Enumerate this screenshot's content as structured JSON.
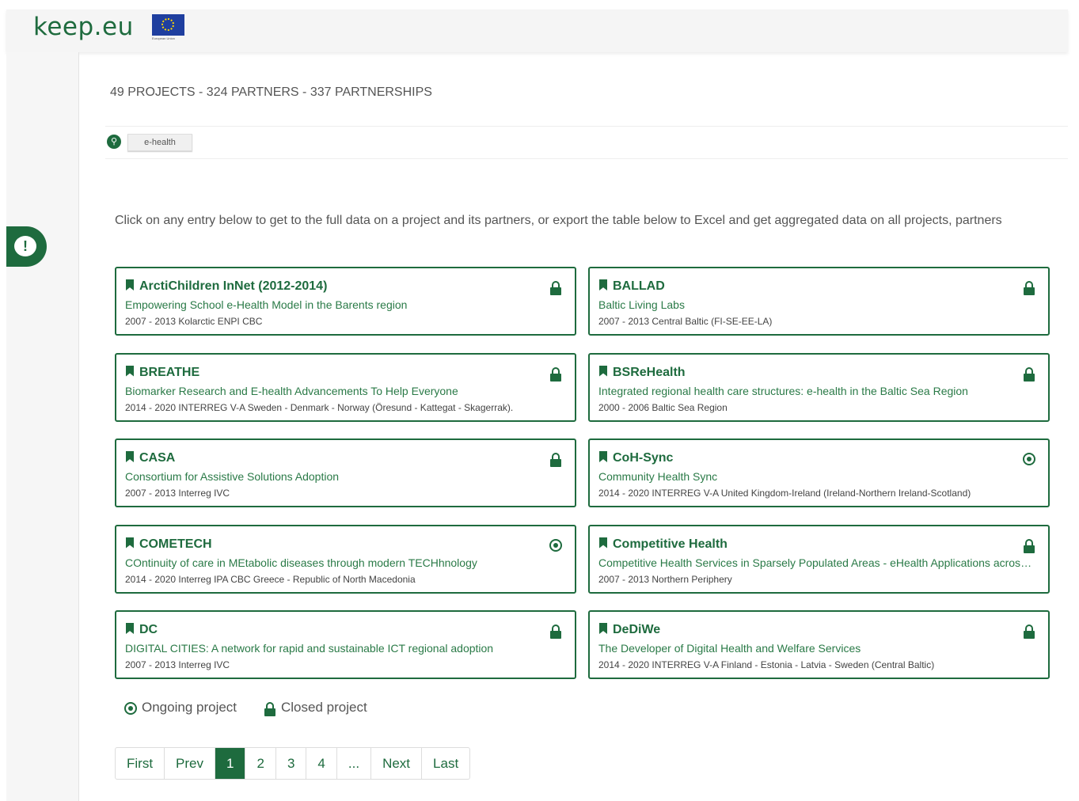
{
  "header": {
    "logo_text": "keep.eu",
    "eu_label": "European Union"
  },
  "summary": "49 PROJECTS - 324 PARTNERS - 337 PARTNERSHIPS",
  "filter": {
    "tag": "e-health"
  },
  "intro": "Click on any entry below to get to the full data on a project and its partners, or export the table below to Excel and get aggregated data on all projects, partners",
  "projects": [
    {
      "title": "ArctiChildren InNet (2012-2014)",
      "subtitle": "Empowering School e-Health Model in the Barents region",
      "meta": "2007 - 2013 Kolarctic ENPI CBC",
      "status": "closed"
    },
    {
      "title": "BALLAD",
      "subtitle": "Baltic Living Labs",
      "meta": "2007 - 2013 Central Baltic (FI-SE-EE-LA)",
      "status": "closed"
    },
    {
      "title": "BREATHE",
      "subtitle": "Biomarker Research and E-health Advancements To Help Everyone",
      "meta": "2014 - 2020 INTERREG V-A Sweden - Denmark - Norway (Öresund - Kattegat - Skagerrak).",
      "status": "closed"
    },
    {
      "title": "BSReHealth",
      "subtitle": "Integrated regional health care structures: e-health in the Baltic Sea Region",
      "meta": "2000 - 2006 Baltic Sea Region",
      "status": "closed"
    },
    {
      "title": "CASA",
      "subtitle": "Consortium for Assistive Solutions Adoption",
      "meta": "2007 - 2013 Interreg IVC",
      "status": "closed"
    },
    {
      "title": "CoH-Sync",
      "subtitle": "Community Health Sync",
      "meta": "2014 - 2020 INTERREG V-A United Kingdom-Ireland (Ireland-Northern Ireland-Scotland)",
      "status": "ongoing"
    },
    {
      "title": "COMETECH",
      "subtitle": "COntinuity of care in MEtabolic diseases through modern TECHhnology",
      "meta": "2014 - 2020 Interreg IPA CBC Greece - Republic of North Macedonia",
      "status": "ongoing"
    },
    {
      "title": "Competitive Health",
      "subtitle": "Competitive Health Services in Sparsely Populated Areas - eHealth Applications across ...",
      "meta": "2007 - 2013 Northern Periphery",
      "status": "closed"
    },
    {
      "title": "DC",
      "subtitle": "DIGITAL CITIES: A network for rapid and sustainable ICT regional adoption",
      "meta": "2007 - 2013 Interreg IVC",
      "status": "closed"
    },
    {
      "title": "DeDiWe",
      "subtitle": "The Developer of Digital Health and Welfare Services",
      "meta": "2014 - 2020 INTERREG V-A Finland - Estonia - Latvia - Sweden (Central Baltic)",
      "status": "closed"
    }
  ],
  "legend": {
    "ongoing": "Ongoing project",
    "closed": "Closed project"
  },
  "pagination": [
    "First",
    "Prev",
    "1",
    "2",
    "3",
    "4",
    "...",
    "Next",
    "Last"
  ],
  "pagination_active": "1"
}
